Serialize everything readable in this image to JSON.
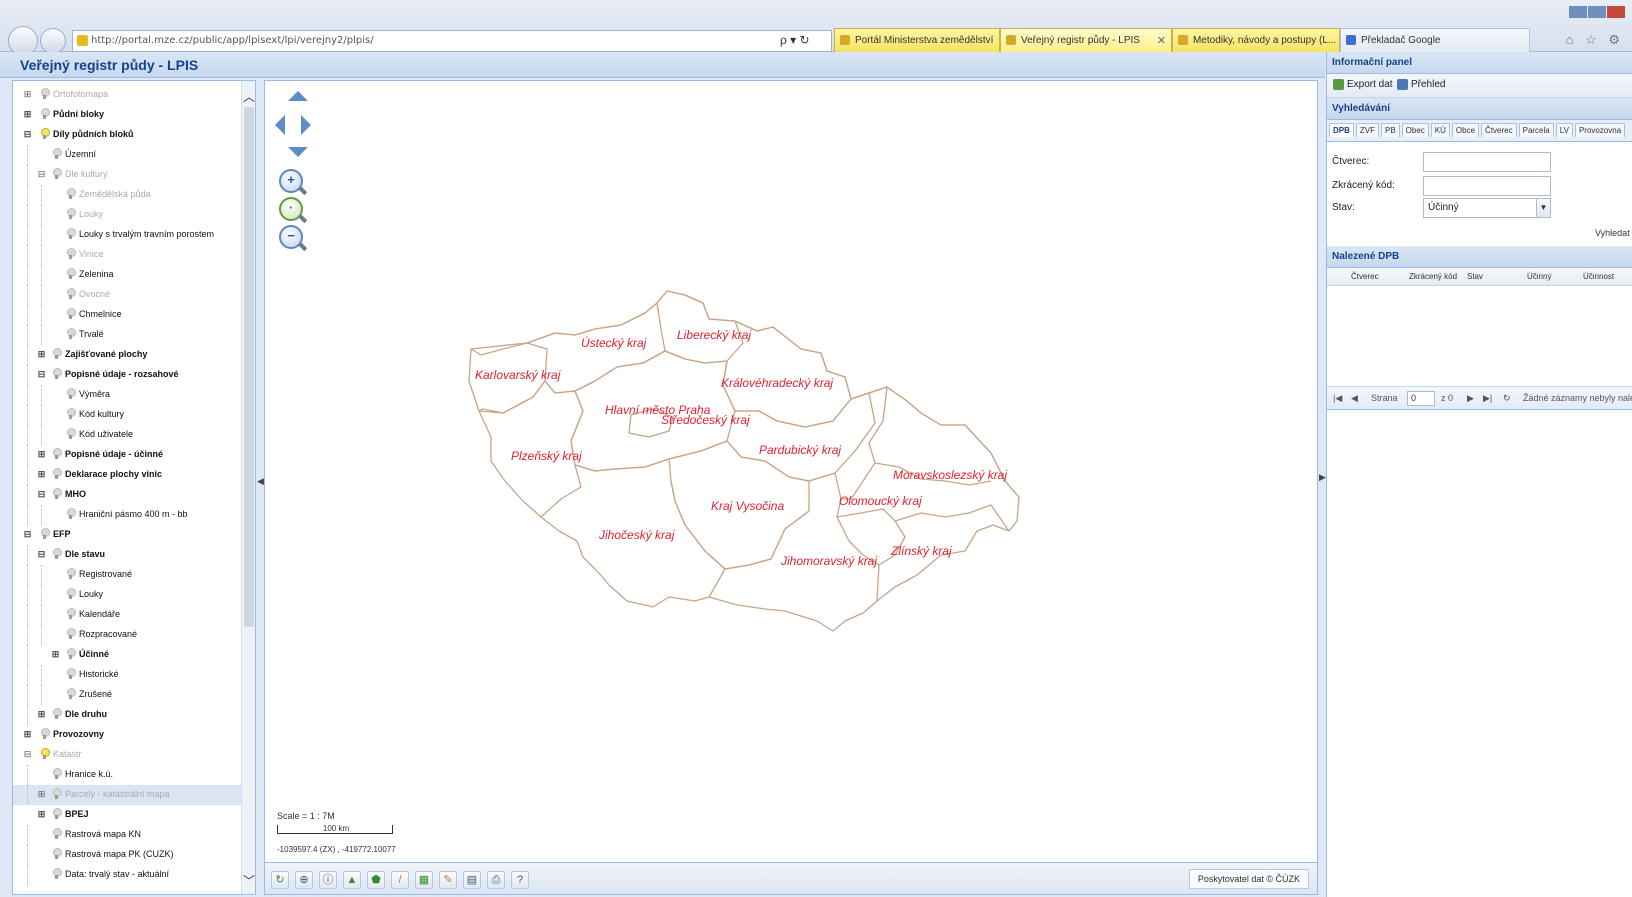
{
  "browser": {
    "url": "http://portal.mze.cz/public/app/lpisext/lpi/verejny2/plpis/",
    "tools": "ρ ▾ ↻",
    "tabs": [
      {
        "label": "Portál Ministerstva zemědělství"
      },
      {
        "label": "Veřejný registr půdy - LPIS"
      },
      {
        "label": "Metodiky, návody a postupy (L..."
      },
      {
        "label": "Překladač Google"
      }
    ],
    "icons": "⌂ ☆ ⚙"
  },
  "app": {
    "title": "Veřejný registr půdy - LPIS"
  },
  "tree": {
    "items": [
      {
        "label": "Ortofotomapa"
      },
      {
        "label": "Půdní bloky"
      },
      {
        "label": "Díly půdních bloků"
      },
      {
        "label": "Územní"
      },
      {
        "label": "Dle kultury"
      },
      {
        "label": "Zemědělská půda"
      },
      {
        "label": "Louky"
      },
      {
        "label": "Louky s trvalým travním porostem"
      },
      {
        "label": "Vinice"
      },
      {
        "label": "Zelenina"
      },
      {
        "label": "Ovocné"
      },
      {
        "label": "Chmelnice"
      },
      {
        "label": "Trvalé"
      },
      {
        "label": "Zajišťované plochy"
      },
      {
        "label": "Popisné údaje - rozsahové"
      },
      {
        "label": "Výměra"
      },
      {
        "label": "Kód kultury"
      },
      {
        "label": "Kód uživatele"
      },
      {
        "label": "Popisné údaje - účinné"
      },
      {
        "label": "Deklarace plochy vinic"
      },
      {
        "label": "MHO"
      },
      {
        "label": "Hraniční pásmo 400 m - bb"
      },
      {
        "label": "EFP"
      },
      {
        "label": "Dle stavu"
      },
      {
        "label": "Registrované"
      },
      {
        "label": "Louky"
      },
      {
        "label": "Kalendáře"
      },
      {
        "label": "Rozpracované"
      },
      {
        "label": "Účinné"
      },
      {
        "label": "Historické"
      },
      {
        "label": "Zrušené"
      },
      {
        "label": "Dle druhu"
      },
      {
        "label": "Provozovny"
      },
      {
        "label": "Katastr"
      },
      {
        "label": "Hranice k.ú."
      },
      {
        "label": "Parcely - katastrální mapa"
      },
      {
        "label": "BPEJ"
      },
      {
        "label": "Rastrová mapa KN"
      },
      {
        "label": "Rastrová mapa PK (CUZK)"
      },
      {
        "label": "Data: trvalý stav - aktuální"
      }
    ]
  },
  "map": {
    "regions": [
      {
        "name": "Ústecký kraj"
      },
      {
        "name": "Liberecký kraj"
      },
      {
        "name": "Karlovarský kraj"
      },
      {
        "name": "Královéhradecký kraj"
      },
      {
        "name": "Hlavní město Praha"
      },
      {
        "name": "Středočeský kraj"
      },
      {
        "name": "Plzeňský kraj"
      },
      {
        "name": "Pardubický kraj"
      },
      {
        "name": "Moravskoslezský kraj"
      },
      {
        "name": "Kraj Vysočina"
      },
      {
        "name": "Olomoucký kraj"
      },
      {
        "name": "Jihočeský kraj"
      },
      {
        "name": "Zlínský kraj"
      },
      {
        "name": "Jihomoravský kraj"
      }
    ],
    "scale_label": "Scale = 1 : 7M",
    "scale_bar_label": "100 km",
    "coords": "-1039597.4 (ZX) , -419772.10077"
  },
  "map_toolbar": {
    "provider": "Poskytovatel dat © ČÚZK"
  },
  "info": {
    "panel_title": "Informační panel",
    "export_label": "Export dat",
    "print_label": "Přehled",
    "search_title": "Vyhledávání",
    "search_tabs": [
      "DPB",
      "ZVF",
      "PB",
      "Obec",
      "KÚ",
      "Obce",
      "Čtverec",
      "Parcela",
      "LV",
      "Provozovna"
    ],
    "form": {
      "ctverec_label": "Čtverec:",
      "zkraceny_kod_label": "Zkrácený kód:",
      "stav_label": "Stav:",
      "stav_value": "Účinný"
    },
    "search_button": "Vyhledat",
    "results_title": "Nalezené DPB",
    "grid_columns": [
      "Čtverec",
      "Zkrácený kód",
      "Stav",
      "Účinný",
      "Účinnost"
    ],
    "pager": {
      "page_label": "Strana",
      "page_value": "0",
      "of_label": "z 0",
      "empty_text": "Žádné záznamy nebyly nalezeny"
    }
  }
}
